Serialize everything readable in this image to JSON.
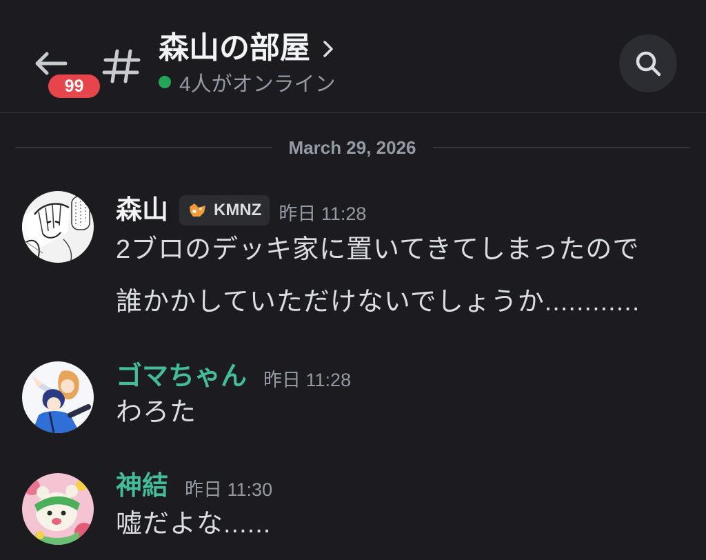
{
  "header": {
    "back_button": {
      "icon": "arrow-left-icon",
      "unread_badge": "99"
    },
    "channel_icon": "hash-icon",
    "channel_name": "森山の部屋",
    "title_chevron_icon": "chevron-right-icon",
    "online_status": "4人がオンライン",
    "search_icon": "search-icon"
  },
  "date_divider": "March 29, 2026",
  "messages": [
    {
      "author": "森山",
      "author_color": "#f2f3f5",
      "tag": {
        "icon": "kmnz-tag-icon",
        "label": "KMNZ"
      },
      "timestamp": "昨日 11:28",
      "lines": [
        "2ブロのデッキ家に置いてきてしまったので",
        "誰かかしていただけないでしょうか............"
      ]
    },
    {
      "author": "ゴマちゃん",
      "author_color": "#44bc9c",
      "timestamp": "昨日 11:28",
      "lines": [
        "わろた"
      ]
    },
    {
      "author": "神結",
      "author_color": "#44bc9c",
      "timestamp": "昨日 11:30",
      "lines": [
        "嘘だよな......"
      ]
    }
  ],
  "colors": {
    "background": "#1c1c20",
    "unread_badge": "#e5454b",
    "online_dot": "#23a55a",
    "text_primary": "#f2f3f5",
    "text_muted": "#949ba4",
    "role_teal": "#44bc9c"
  }
}
